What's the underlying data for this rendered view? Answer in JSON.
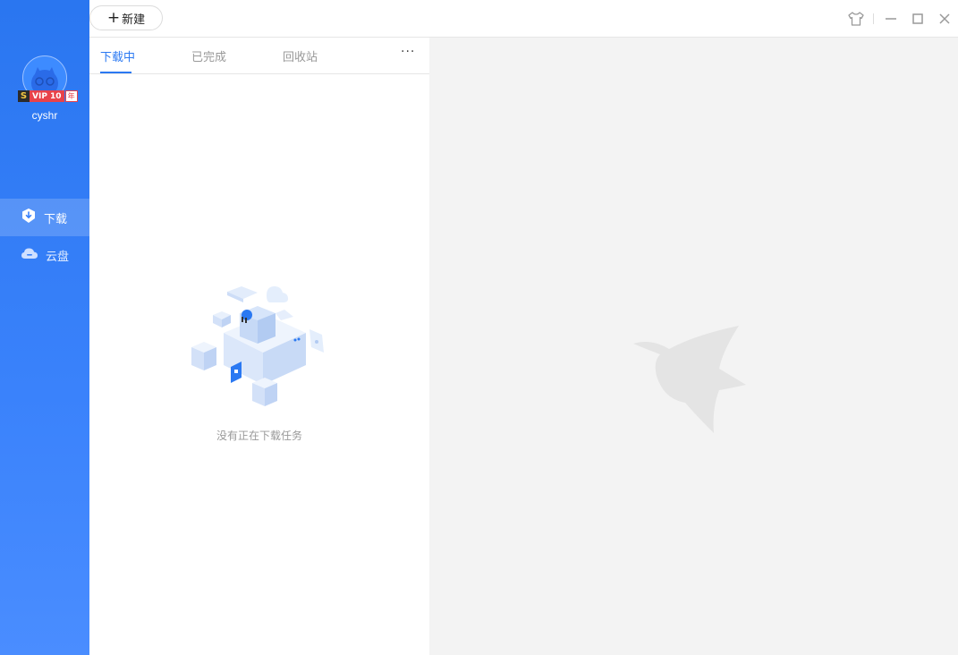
{
  "user": {
    "name": "cyshr",
    "vip_s": "S",
    "vip_label": "VIP 10",
    "vip_year": "年"
  },
  "sidebar": {
    "items": [
      {
        "label": "下载",
        "icon": "download-shield-icon",
        "active": true
      },
      {
        "label": "云盘",
        "icon": "cloud-icon",
        "active": false
      }
    ]
  },
  "toolbar": {
    "new_label": "新建",
    "new_icon": "plus-icon"
  },
  "window_controls": {
    "icons": [
      "skin-shirt-icon",
      "minimize-icon",
      "maximize-icon",
      "close-icon"
    ]
  },
  "tabs": [
    {
      "label": "下载中",
      "active": true
    },
    {
      "label": "已完成",
      "active": false
    },
    {
      "label": "回收站",
      "active": false
    }
  ],
  "more_label": "···",
  "empty_state": {
    "message": "没有正在下载任务"
  },
  "colors": {
    "accent": "#2b79f2",
    "sidebar": "#3a82fb",
    "right_bg": "#f3f3f3",
    "vip_red": "#e8424a"
  }
}
